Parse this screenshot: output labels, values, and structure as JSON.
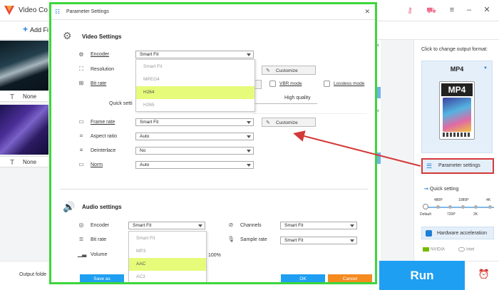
{
  "app": {
    "title": "Video Co",
    "add_files": "Add Fi",
    "output_folder": "Output folde",
    "run": "Run"
  },
  "files": [
    {
      "subtitle": "None"
    },
    {
      "subtitle": "None"
    }
  ],
  "right_panel": {
    "click_to_change": "Click to change output format:",
    "format": "MP4",
    "format_icon_label": "MP4",
    "parameter_settings": "Parameter settings",
    "quick_setting": "Quick setting",
    "quick_top_labels": [
      "480P",
      "1080P",
      "4K"
    ],
    "quick_bottom_labels": [
      "Default",
      "720P",
      "2K"
    ],
    "hardware_acceleration": "Hardware acceleration",
    "nvidia": "NVIDIA",
    "intel": "Intel"
  },
  "dialog": {
    "title": "Parameter Settings",
    "video_settings": "Video Settings",
    "audio_settings": "Audio settings",
    "encoder_label": "Encoder",
    "encoder_value": "Smart Fit",
    "encoder_options": [
      "Smart Fit",
      "MPEG4",
      "H264",
      "H265"
    ],
    "encoder_selected": "H264",
    "resolution_label": "Resolution",
    "customize": "Customize",
    "bitrate_label": "Bit rate",
    "bitrate_partial": "ize",
    "vbr_mode": "VBR mode",
    "lossless_mode": "Lossless mode",
    "quick_setting_partial": "Quick setti",
    "high_quality": "High quality",
    "framerate_label": "Frame rate",
    "framerate_value": "Smart Fit",
    "aspect_label": "Aspect ratio",
    "aspect_value": "Auto",
    "deinterlace_label": "Deinterlace",
    "deinterlace_value": "No",
    "norm_label": "Norm",
    "norm_value": "Auto",
    "audio_encoder_label": "Encoder",
    "audio_encoder_value": "Smart Fit",
    "audio_encoder_options": [
      "Smart Fit",
      "MP3",
      "AAC",
      "AC3"
    ],
    "audio_encoder_selected": "AAC",
    "audio_bitrate_label": "Bit rate",
    "volume_label": "Volume",
    "volume_value": "100%",
    "channels_label": "Channels",
    "channels_value": "Smart Fit",
    "samplerate_label": "Sample rate",
    "samplerate_value": "Smart Fit",
    "save_as": "Save as",
    "ok": "OK",
    "cancel": "Cancel"
  },
  "colors": {
    "accent_blue": "#1e9ff2",
    "dialog_border_green": "#3cd63c",
    "highlight_red": "#d43939",
    "selection_yellow": "#e6fb7a",
    "cancel_orange": "#f58a1f"
  }
}
